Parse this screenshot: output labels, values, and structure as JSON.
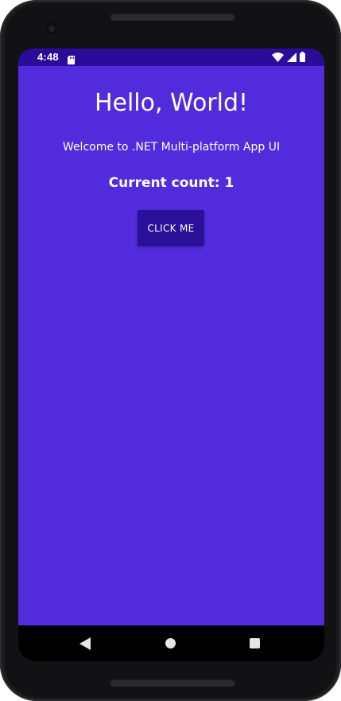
{
  "status_bar": {
    "time": "4:48",
    "icons": [
      "sd-card-icon",
      "wifi-icon",
      "cellular-signal-icon",
      "battery-icon"
    ]
  },
  "app": {
    "title": "Hello, World!",
    "welcome": "Welcome to .NET Multi-platform App UI",
    "count_text": "Current count: 1",
    "button_label": "CLICK ME"
  },
  "nav_bar": {
    "icons": [
      "back-icon",
      "home-icon",
      "recents-icon"
    ]
  },
  "colors": {
    "background": "#512bdc",
    "status_bar": "#2b0c9a",
    "button": "#2a0f98",
    "text": "#ffffff"
  }
}
